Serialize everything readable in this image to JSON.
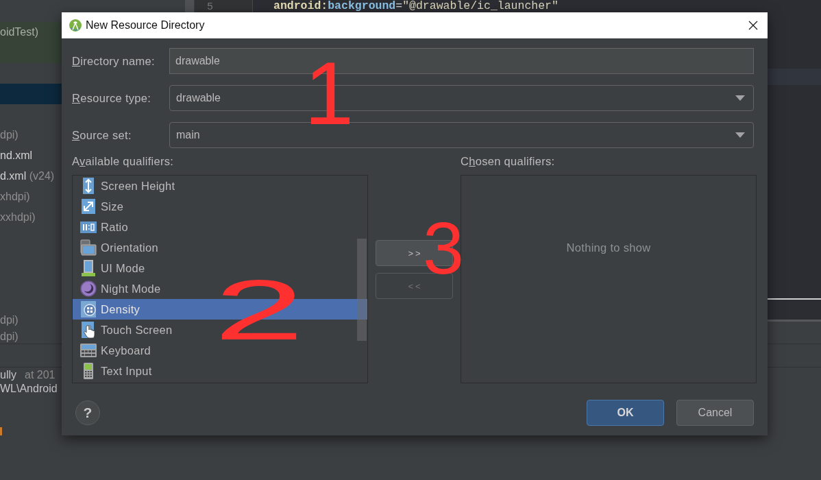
{
  "ide": {
    "editor": {
      "line_number": "5",
      "code": [
        {
          "kind": "namespace",
          "text": "android"
        },
        {
          "kind": "punct",
          "text": ":"
        },
        {
          "kind": "attribute",
          "text": "background"
        },
        {
          "kind": "plain",
          "text": "="
        },
        {
          "kind": "string",
          "text": "\"@drawable/ic_launcher\""
        }
      ]
    },
    "project_tree": {
      "items": [
        {
          "kind": "test_root",
          "note": "oidTest)",
          "selected": false
        },
        {
          "kind": "node",
          "selected": true
        },
        {
          "kind": "node",
          "note": "dpi)",
          "selected": false
        },
        {
          "kind": "node",
          "name": "nd.xml",
          "selected": false
        },
        {
          "kind": "node",
          "name": "d.xml",
          "note": "(v24)",
          "selected": false
        },
        {
          "kind": "node",
          "note": "xhdpi)",
          "selected": false
        },
        {
          "kind": "node",
          "note": "xxhdpi)",
          "selected": false
        },
        {
          "kind": "node",
          "note": "dpi)",
          "selected": false
        },
        {
          "kind": "node",
          "note": "dpi)",
          "selected": false
        }
      ]
    },
    "log": [
      {
        "message": "ully",
        "time": "at 201"
      },
      {
        "message": "WL\\Android"
      }
    ]
  },
  "dialog": {
    "title": "New Resource Directory",
    "fields": [
      {
        "kind": "text",
        "label": "Directory name:",
        "mnemonic": true,
        "value": "drawable"
      },
      {
        "kind": "dropdown",
        "label": "Resource type:",
        "mnemonic": true,
        "value": "drawable"
      },
      {
        "kind": "dropdown",
        "label": "Source set:",
        "mnemonic": true,
        "value": "main"
      }
    ],
    "available": {
      "label": "Available qualifiers:",
      "mnemonic": true,
      "items": [
        {
          "label": "Screen Height",
          "selected": false
        },
        {
          "label": "Size",
          "selected": false
        },
        {
          "label": "Ratio",
          "selected": false
        },
        {
          "label": "Orientation",
          "selected": false
        },
        {
          "label": "UI Mode",
          "selected": false
        },
        {
          "label": "Night Mode",
          "selected": false
        },
        {
          "label": "Density",
          "selected": true
        },
        {
          "label": "Touch Screen",
          "selected": false
        },
        {
          "label": "Keyboard",
          "selected": false
        },
        {
          "label": "Text Input",
          "selected": false
        }
      ]
    },
    "move_buttons": [
      {
        "label": ">>",
        "disabled": false
      },
      {
        "label": "<<",
        "disabled": true
      }
    ],
    "chosen": {
      "label": "Chosen qualifiers:",
      "mnemonic": true,
      "empty_text": "Nothing to show"
    },
    "help": "?",
    "buttons": [
      {
        "label": "OK",
        "kind": "primary"
      },
      {
        "label": "Cancel",
        "kind": "secondary"
      }
    ]
  },
  "annotations": [
    {
      "text": "1"
    },
    {
      "text": "2"
    },
    {
      "text": "3"
    }
  ]
}
